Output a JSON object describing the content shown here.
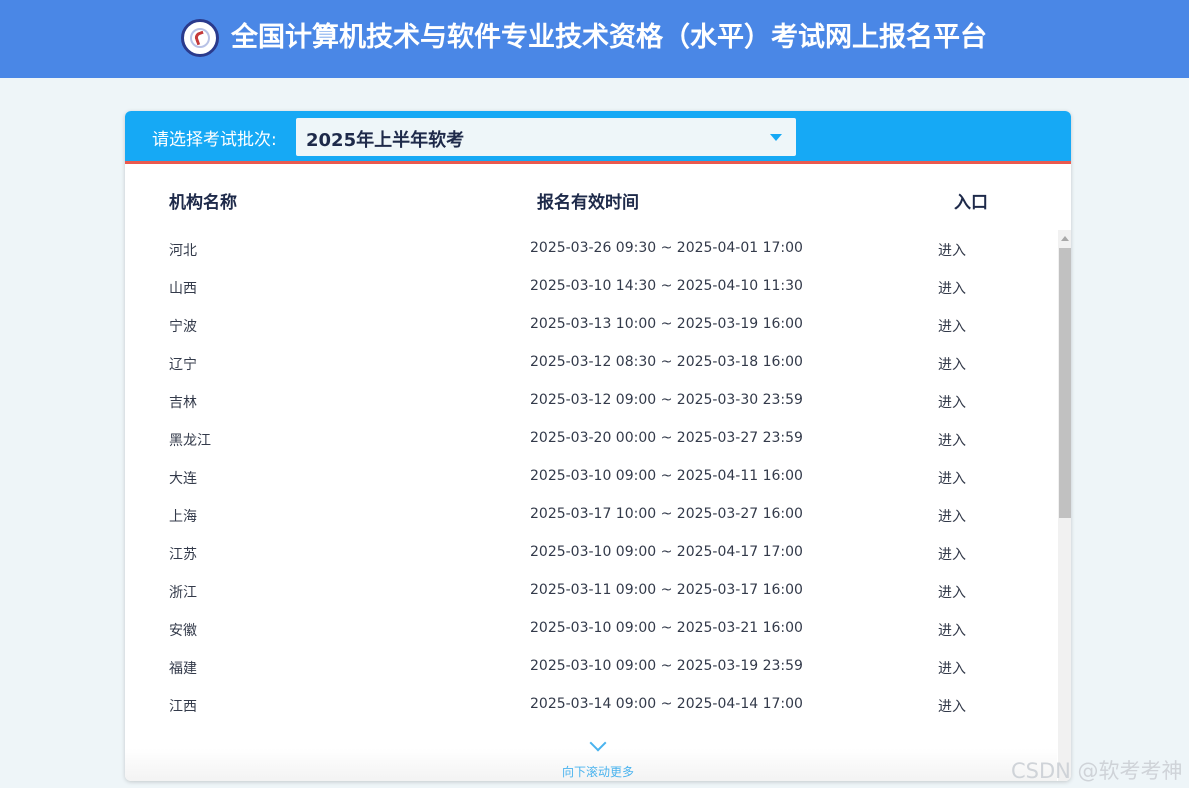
{
  "header": {
    "logo_icon": "exam-seal-logo-icon",
    "title": "全国计算机技术与软件专业技术资格（水平）考试网上报名平台"
  },
  "batch": {
    "label": "请选择考试批次:",
    "selected": "2025年上半年软考",
    "dropdown_icon": "caret-down-icon"
  },
  "table": {
    "columns": [
      "机构名称",
      "报名有效时间",
      "入口"
    ],
    "rows": [
      {
        "name": "河北",
        "time": "2025-03-26 09:30 ~ 2025-04-01 17:00",
        "entry": "进入"
      },
      {
        "name": "山西",
        "time": "2025-03-10 14:30 ~ 2025-04-10 11:30",
        "entry": "进入"
      },
      {
        "name": "宁波",
        "time": "2025-03-13 10:00 ~ 2025-03-19 16:00",
        "entry": "进入"
      },
      {
        "name": "辽宁",
        "time": "2025-03-12 08:30 ~ 2025-03-18 16:00",
        "entry": "进入"
      },
      {
        "name": "吉林",
        "time": "2025-03-12 09:00 ~ 2025-03-30 23:59",
        "entry": "进入"
      },
      {
        "name": "黑龙江",
        "time": "2025-03-20 00:00 ~ 2025-03-27 23:59",
        "entry": "进入"
      },
      {
        "name": "大连",
        "time": "2025-03-10 09:00 ~ 2025-04-11 16:00",
        "entry": "进入"
      },
      {
        "name": "上海",
        "time": "2025-03-17 10:00 ~ 2025-03-27 16:00",
        "entry": "进入"
      },
      {
        "name": "江苏",
        "time": "2025-03-10 09:00 ~ 2025-04-17 17:00",
        "entry": "进入"
      },
      {
        "name": "浙江",
        "time": "2025-03-11 09:00 ~ 2025-03-17 16:00",
        "entry": "进入"
      },
      {
        "name": "安徽",
        "time": "2025-03-10 09:00 ~ 2025-03-21 16:00",
        "entry": "进入"
      },
      {
        "name": "福建",
        "time": "2025-03-10 09:00 ~ 2025-03-19 23:59",
        "entry": "进入"
      },
      {
        "name": "江西",
        "time": "2025-03-14 09:00 ~ 2025-04-14 17:00",
        "entry": "进入"
      }
    ]
  },
  "scroll_hint": {
    "icon": "chevron-down-icon",
    "text": "向下滚动更多"
  },
  "watermark": "CSDN @软考考神",
  "colors": {
    "header_bg": "#4a87e6",
    "card_head_bg": "#16a9f5",
    "accent_line": "#ea5a4f",
    "page_bg": "#eef5f8"
  }
}
